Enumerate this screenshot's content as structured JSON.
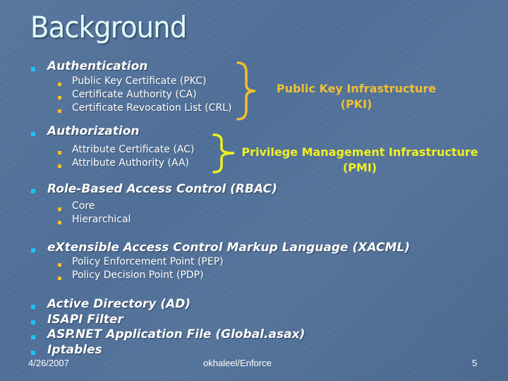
{
  "slide": {
    "title": "Background",
    "colors": {
      "background": "#4f6f98",
      "title": "#e3fbfb",
      "level1_bullet": "#1ec3f0",
      "level2_bullet": "#f0c030",
      "pki_callout": "#f0c030",
      "pmi_callout": "#f0f020"
    },
    "items": [
      {
        "label": "Authentication",
        "subitems": [
          "Public Key Certificate (PKC)",
          "Certificate Authority (CA)",
          "Certificate Revocation List (CRL)"
        ]
      },
      {
        "label": "Authorization",
        "subitems": [
          "Attribute Certificate (AC)",
          "Attribute Authority (AA)"
        ]
      },
      {
        "label": "Role-Based Access Control (RBAC)",
        "subitems": [
          "Core",
          "Hierarchical"
        ]
      },
      {
        "label": "eXtensible Access Control Markup Language (XACML)",
        "subitems": [
          "Policy Enforcement Point (PEP)",
          "Policy Decision Point (PDP)"
        ]
      },
      {
        "label": "Active Directory (AD)",
        "subitems": []
      },
      {
        "label": "ISAPI Filter",
        "subitems": []
      },
      {
        "label": "ASP.NET Application File (Global.asax)",
        "subitems": []
      },
      {
        "label": "Iptables",
        "subitems": []
      }
    ],
    "callouts": {
      "pki": {
        "line1": "Public Key Infrastructure",
        "line2": "(PKI)"
      },
      "pmi": {
        "line1": "Privilege Management Infrastructure",
        "line2": "(PMI)"
      }
    },
    "footer": {
      "date": "4/26/2007",
      "center": "okhaleel/Enforce",
      "page_number": "5"
    }
  }
}
